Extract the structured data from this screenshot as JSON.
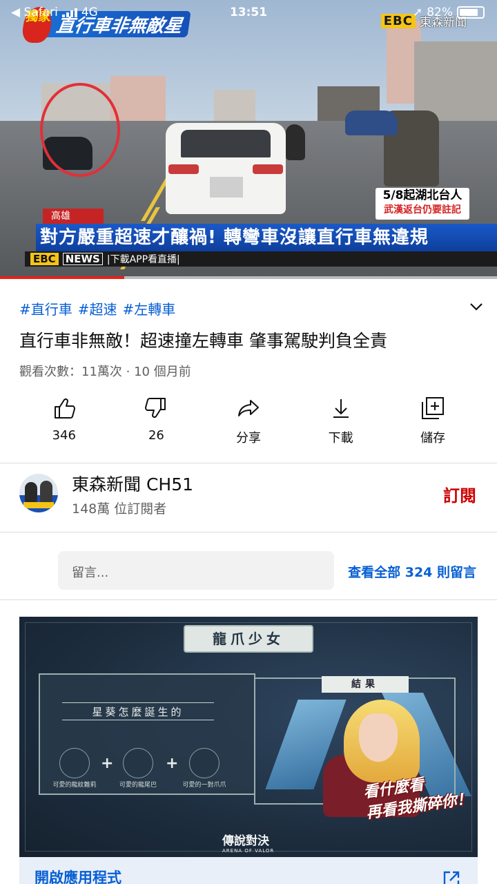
{
  "status_bar": {
    "back_app": "◀ Safari",
    "network": "4G",
    "time": "13:51",
    "battery": "82%",
    "battery_level": 0.82
  },
  "video": {
    "program_logo": "直行車非無敵星",
    "logo_badge": "獨家",
    "channel_logo_box": "EBC",
    "channel_logo_name": "東森新聞",
    "side_card_line1": "5/8起湖北台人",
    "side_card_line2": "武漢返台仍要註記",
    "location_tag": "高雄",
    "headline": "對方嚴重超速才釀禍! 轉彎車沒讓直行車無違規",
    "ticker_logo": "EBC",
    "ticker_news": "NEWS",
    "ticker_text": "|下載APP看直播|",
    "progress": 0.25,
    "accent_color": "#e62117"
  },
  "info": {
    "hashtags": [
      "#直行車",
      "#超速",
      "#左轉車"
    ],
    "title": "直行車非無敵！超速撞左轉車 肇事駕駛判負全責",
    "meta": "觀看次數：11萬次 · 10 個月前",
    "expand_icon": "chevron-down-icon"
  },
  "actions": [
    {
      "icon": "thumb-up-icon",
      "label": "346"
    },
    {
      "icon": "thumb-down-icon",
      "label": "26"
    },
    {
      "icon": "share-icon",
      "label": "分享"
    },
    {
      "icon": "download-icon",
      "label": "下載"
    },
    {
      "icon": "save-icon",
      "label": "儲存"
    }
  ],
  "channel": {
    "name": "東森新聞 CH51",
    "subscribers": "148萬 位訂閱者",
    "subscribe_label": "訂閱",
    "subscribe_color": "#cc0000"
  },
  "comments": {
    "placeholder": "留言...",
    "view_all": "查看全部 324 則留言"
  },
  "ad": {
    "title": "龍爪少女",
    "subtitle": "星葵怎麼誕生的",
    "items": [
      "可愛的龍紋難莉",
      "可愛的龍尾巴",
      "可愛的一對爪爪"
    ],
    "result_label": "結果",
    "slogan_line1": "看什麼看",
    "slogan_line2": "再看我撕碎你！",
    "brand": "傳說對決",
    "brand_sub": "ARENA OF VALOR",
    "cta_label": "開啟應用程式",
    "cta_icon": "external-link-icon"
  },
  "link_color": "#065fd4"
}
